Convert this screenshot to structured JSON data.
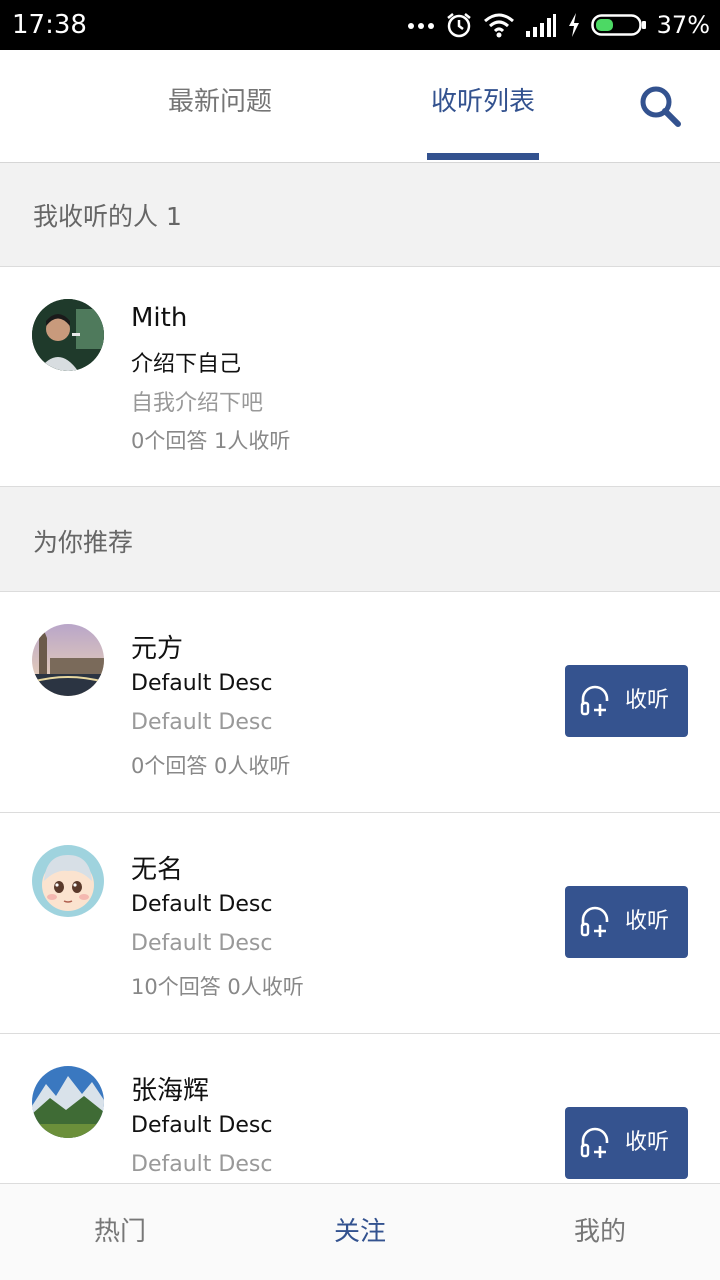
{
  "status_bar": {
    "time": "17:38",
    "battery_percent": "37%",
    "icons": [
      "more-dots-icon",
      "alarm-icon",
      "wifi-icon",
      "signal-icon",
      "charging-icon",
      "battery-icon"
    ]
  },
  "top_tabs": {
    "items": [
      {
        "label": "最新问题",
        "active": false
      },
      {
        "label": "收听列表",
        "active": true
      }
    ],
    "search_icon": "search-icon"
  },
  "sections": {
    "following_header": "我收听的人 1",
    "recommend_header": "为你推荐"
  },
  "following": [
    {
      "name": "Mith",
      "title": "介绍下自己",
      "desc": "自我介绍下吧",
      "stats": "0个回答 1人收听"
    }
  ],
  "recommended": [
    {
      "name": "元方",
      "title": "Default Desc",
      "desc": "Default Desc",
      "stats": "0个回答 0人收听",
      "button": "收听"
    },
    {
      "name": "无名",
      "title": "Default Desc",
      "desc": "Default Desc",
      "stats": "10个回答 0人收听",
      "button": "收听"
    },
    {
      "name": "张海辉",
      "title": "Default Desc",
      "desc": "Default Desc",
      "button": "收听"
    }
  ],
  "bottom_nav": {
    "items": [
      {
        "label": "热门",
        "active": false
      },
      {
        "label": "关注",
        "active": true
      },
      {
        "label": "我的",
        "active": false
      }
    ]
  },
  "colors": {
    "accent": "#33528f",
    "button_bg": "#35538f",
    "section_bg": "#f2f2f2"
  }
}
